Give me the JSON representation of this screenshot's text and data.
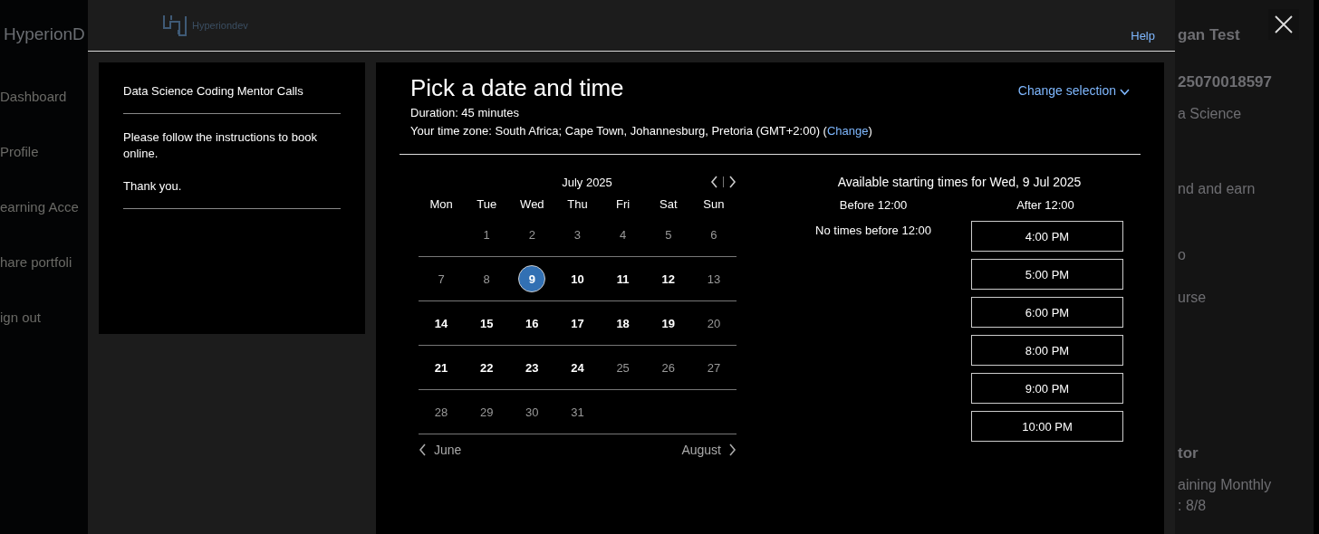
{
  "background": {
    "brand": "HyperionD",
    "nav": [
      "Dashboard",
      "Profile",
      "earning Acce",
      "hare portfoli",
      "ign out"
    ],
    "side_texts": [
      {
        "text": "gan Test",
        "bold": true
      },
      {
        "text": "25070018597",
        "bold": true
      },
      {
        "text": "a Science",
        "bold": false
      },
      {
        "text": "nd and earn",
        "bold": false
      },
      {
        "text": "o",
        "bold": false
      },
      {
        "text": "urse",
        "bold": false
      },
      {
        "text": "tor",
        "bold": true
      },
      {
        "text": "aining Monthly",
        "bold": false
      },
      {
        "text": ": 8/8",
        "bold": false
      }
    ]
  },
  "modal": {
    "logo_text": "Hyperiondev",
    "help": "Help",
    "service": {
      "title": "Data Science Coding Mentor Calls",
      "message": [
        "Please follow the instructions to book online.",
        "Thank you."
      ]
    },
    "booking": {
      "title": "Pick a date and time",
      "duration": "Duration: 45 minutes",
      "timezone": "Your time zone: South Africa;  Cape Town, Johannesburg, Pretoria  (GMT+2:00)  (",
      "timezone_link": "Change",
      "timezone_end": ")",
      "change_selection": "Change selection",
      "calendar": {
        "month": "July 2025",
        "weekdays": [
          "Mon",
          "Tue",
          "Wed",
          "Thu",
          "Fri",
          "Sat",
          "Sun"
        ],
        "weeks": [
          [
            {
              "day": "1",
              "available": false,
              "selected": false
            },
            {
              "day": "2",
              "available": false,
              "selected": false
            },
            {
              "day": "3",
              "available": false,
              "selected": false
            },
            {
              "day": "4",
              "available": false,
              "selected": false
            },
            {
              "day": "5",
              "available": false,
              "selected": false
            },
            {
              "day": "6",
              "available": false,
              "selected": false
            }
          ],
          [
            {
              "day": "7",
              "available": false,
              "selected": false
            },
            {
              "day": "8",
              "available": false,
              "selected": false
            },
            {
              "day": "9",
              "available": true,
              "selected": true
            },
            {
              "day": "10",
              "available": true,
              "selected": false
            },
            {
              "day": "11",
              "available": true,
              "selected": false
            },
            {
              "day": "12",
              "available": true,
              "selected": false
            },
            {
              "day": "13",
              "available": false,
              "selected": false
            }
          ],
          [
            {
              "day": "14",
              "available": true,
              "selected": false
            },
            {
              "day": "15",
              "available": true,
              "selected": false
            },
            {
              "day": "16",
              "available": true,
              "selected": false
            },
            {
              "day": "17",
              "available": true,
              "selected": false
            },
            {
              "day": "18",
              "available": true,
              "selected": false
            },
            {
              "day": "19",
              "available": true,
              "selected": false
            },
            {
              "day": "20",
              "available": false,
              "selected": false
            }
          ],
          [
            {
              "day": "21",
              "available": true,
              "selected": false
            },
            {
              "day": "22",
              "available": true,
              "selected": false
            },
            {
              "day": "23",
              "available": true,
              "selected": false
            },
            {
              "day": "24",
              "available": true,
              "selected": false
            },
            {
              "day": "25",
              "available": false,
              "selected": false
            },
            {
              "day": "26",
              "available": false,
              "selected": false
            },
            {
              "day": "27",
              "available": false,
              "selected": false
            }
          ],
          [
            {
              "day": "28",
              "available": false,
              "selected": false
            },
            {
              "day": "29",
              "available": false,
              "selected": false
            },
            {
              "day": "30",
              "available": false,
              "selected": false
            },
            {
              "day": "31",
              "available": false,
              "selected": false
            }
          ]
        ],
        "prev_month": "June",
        "next_month": "August"
      },
      "times": {
        "heading": "Available starting times for Wed, 9 Jul 2025",
        "before_label": "Before 12:00",
        "before_message": "No times before 12:00",
        "after_label": "After 12:00",
        "slots": [
          "4:00 PM",
          "5:00 PM",
          "6:00 PM",
          "8:00 PM",
          "9:00 PM",
          "10:00 PM"
        ]
      }
    }
  }
}
